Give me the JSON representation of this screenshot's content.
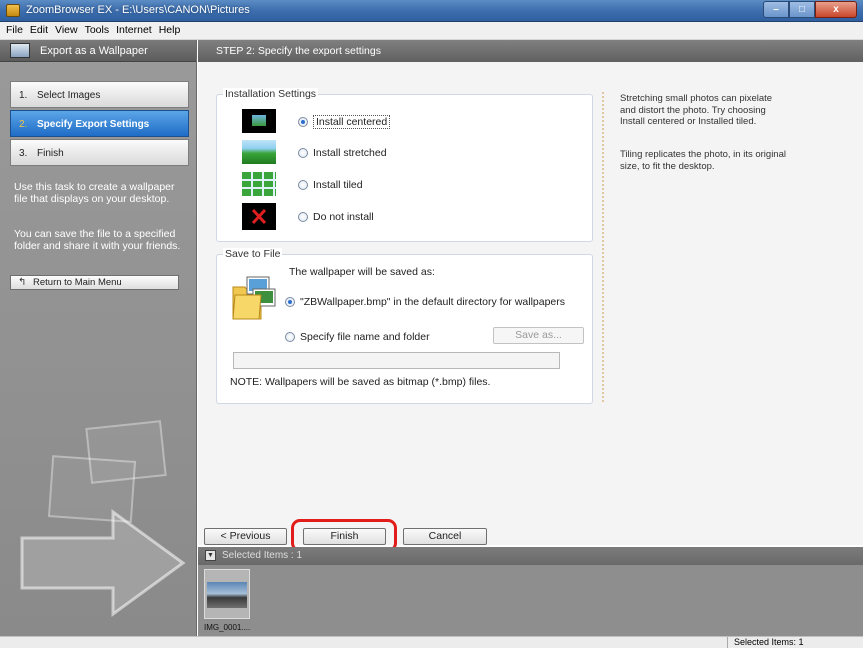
{
  "window": {
    "title": "ZoomBrowser EX  -  E:\\Users\\CANON\\Pictures",
    "minimize_label": "–",
    "maximize_label": "□",
    "close_label": "x"
  },
  "menu": [
    "File",
    "Edit",
    "View",
    "Tools",
    "Internet",
    "Help"
  ],
  "left_panel": {
    "title": "Export as a Wallpaper",
    "steps": [
      {
        "num": "1.",
        "label": "Select Images"
      },
      {
        "num": "2.",
        "label": "Specify Export Settings"
      },
      {
        "num": "3.",
        "label": "Finish"
      }
    ],
    "info_text_1": "Use this task to create a wallpaper file that displays on your desktop.",
    "info_text_2": "You can save the file to a specified folder and share it with your friends.",
    "return_button": "Return to Main Menu"
  },
  "main": {
    "step_title": "STEP 2: Specify the export settings",
    "installation": {
      "title": "Installation Settings",
      "options": [
        "Install centered",
        "Install stretched",
        "Install tiled",
        "Do not install"
      ],
      "selected_index": 0
    },
    "save": {
      "title": "Save to File",
      "caption": "The wallpaper will be saved as:",
      "option_default": "\"ZBWallpaper.bmp\" in the default directory for wallpapers",
      "option_specify": "Specify file name and folder",
      "save_as_button": "Save as...",
      "path_value": "",
      "note": "NOTE: Wallpapers will be saved as bitmap (*.bmp) files."
    },
    "help": {
      "text_1": "Stretching small photos can pixelate and distort the photo. Try choosing Install centered or Installed tiled.",
      "text_2": "Tiling replicates the photo, in its original size, to fit the desktop."
    },
    "buttons": {
      "previous": "< Previous",
      "finish": "Finish",
      "cancel": "Cancel"
    }
  },
  "selected_items": {
    "header": "Selected Items : 1",
    "thumb_label": "IMG_0001...."
  },
  "status_bar": {
    "text": "Selected Items: 1"
  }
}
